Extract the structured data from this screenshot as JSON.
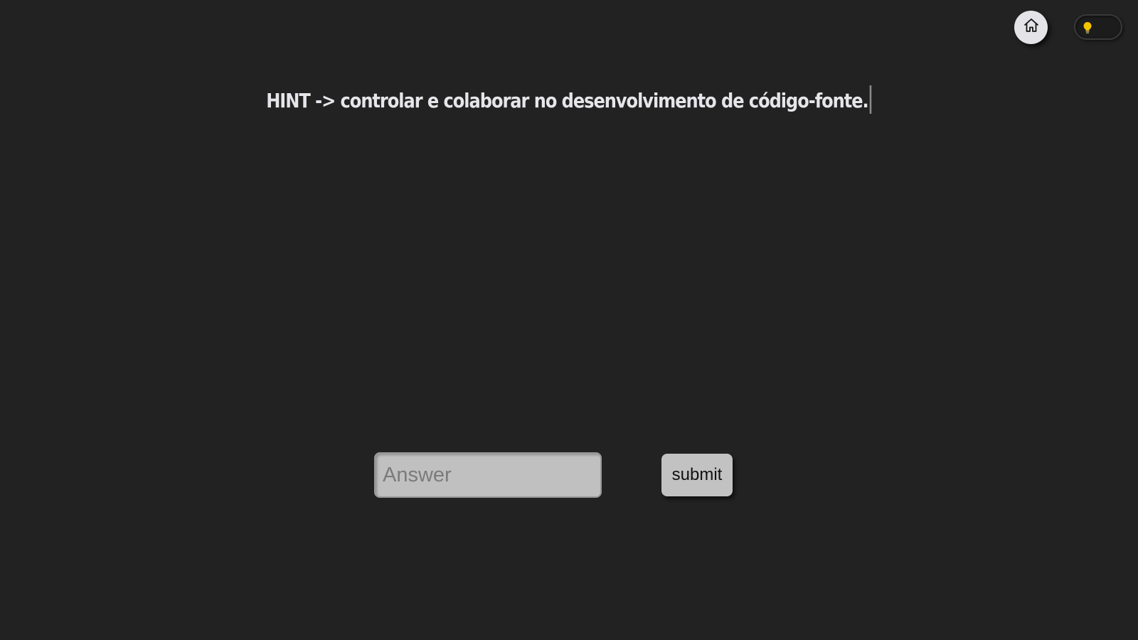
{
  "header": {
    "home_icon": "home-icon",
    "theme_toggle_icon": "lightbulb-icon",
    "bulb_color": "#f5c400"
  },
  "hint": {
    "text": "HINT -> controlar e colaborar no desenvolvimento de código-fonte."
  },
  "answer_form": {
    "input_value": "",
    "input_placeholder": "Answer",
    "submit_label": "submit"
  },
  "colors": {
    "background": "#222222",
    "text": "#e6e6ea",
    "input_background": "#c0c0c0",
    "button_background": "#c2c2c2"
  }
}
